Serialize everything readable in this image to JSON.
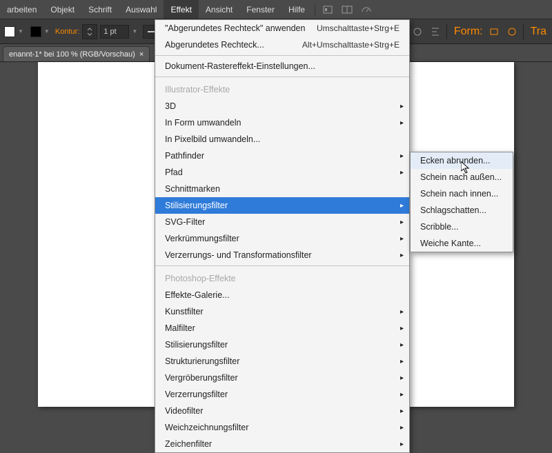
{
  "menubar": {
    "items": [
      {
        "label": "arbeiten"
      },
      {
        "label": "Objekt"
      },
      {
        "label": "Schrift"
      },
      {
        "label": "Auswahl"
      },
      {
        "label": "Effekt"
      },
      {
        "label": "Ansicht"
      },
      {
        "label": "Fenster"
      },
      {
        "label": "Hilfe"
      }
    ],
    "active_index": 4
  },
  "toolbar": {
    "kontur_label": "Kontur:",
    "stroke_value": "1 pt",
    "form_label": "Form:",
    "tra_label": "Tra"
  },
  "tab": {
    "title": "enannt-1* bei 100 % (RGB/Vorschau)"
  },
  "dropdown": {
    "apply": {
      "label": "\"Abgerundetes Rechteck\" anwenden",
      "shortcut": "Umschalttaste+Strg+E"
    },
    "redo": {
      "label": "Abgerundetes Rechteck...",
      "shortcut": "Alt+Umschalttaste+Strg+E"
    },
    "raster": {
      "label": "Dokument-Rastereffekt-Einstellungen..."
    },
    "section_illustrator": "Illustrator-Effekte",
    "ill_items": [
      "3D",
      "In Form umwandeln",
      "In Pixelbild umwandeln...",
      "Pathfinder",
      "Pfad",
      "Schnittmarken",
      "Stilisierungsfilter",
      "SVG-Filter",
      "Verkrümmungsfilter",
      "Verzerrungs- und Transformationsfilter"
    ],
    "highlight_index": 6,
    "section_photoshop": "Photoshop-Effekte",
    "ps_items": [
      "Effekte-Galerie...",
      "Kunstfilter",
      "Malfilter",
      "Stilisierungsfilter",
      "Strukturierungsfilter",
      "Vergröberungsfilter",
      "Verzerrungsfilter",
      "Videofilter",
      "Weichzeichnungsfilter",
      "Zeichenfilter"
    ]
  },
  "submenu": {
    "items": [
      "Ecken abrunden...",
      "Schein nach außen...",
      "Schein nach innen...",
      "Schlagschatten...",
      "Scribble...",
      "Weiche Kante..."
    ],
    "hover_index": 0
  }
}
